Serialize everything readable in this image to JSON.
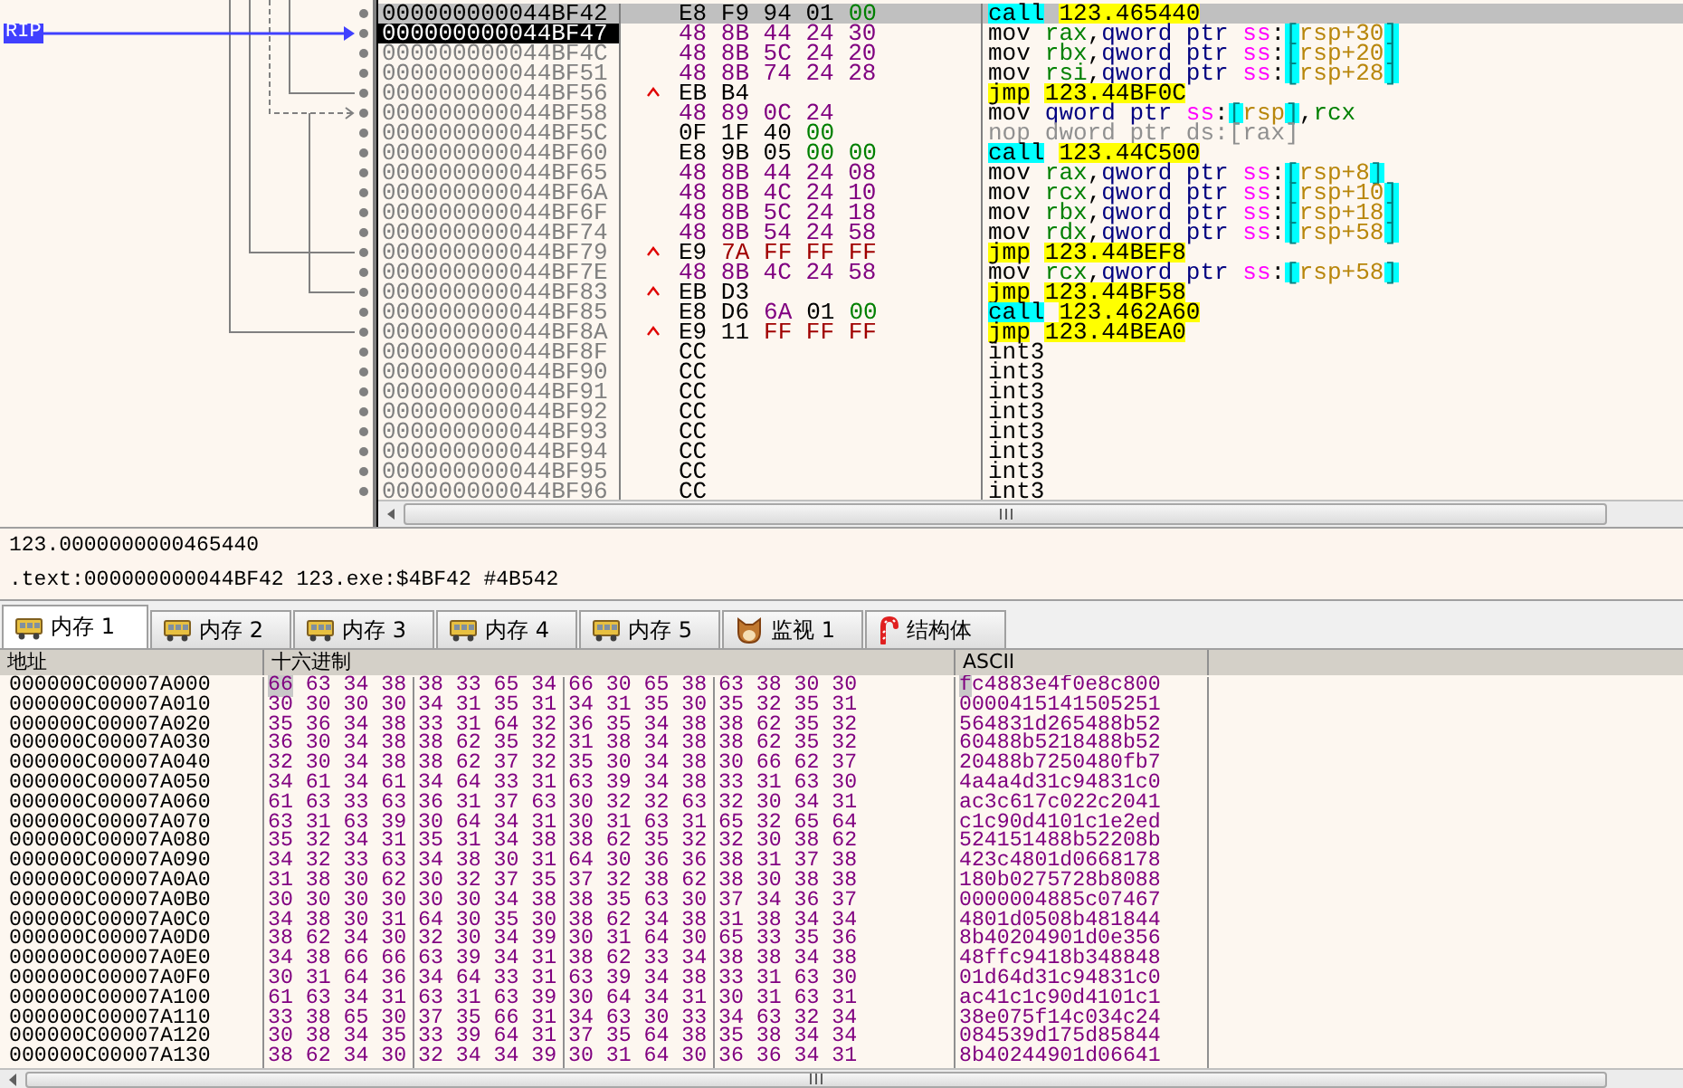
{
  "gutter": {
    "rip_label": "RIP"
  },
  "disassembly": [
    {
      "address": "000000000044BF42",
      "selected": true,
      "is_rip": false,
      "jump_up": false,
      "bytes": [
        {
          "text": "E8 F9 94 01",
          "kind": "opcode"
        },
        {
          "text": "00",
          "kind": "zero"
        }
      ],
      "instruction": [
        {
          "text": "call",
          "kind": "call"
        },
        {
          "text": "123.465440",
          "kind": "target"
        }
      ]
    },
    {
      "address": "000000000044BF47",
      "selected": false,
      "is_rip": true,
      "jump_up": false,
      "bytes": [
        {
          "text": "48 8B 44 24 30",
          "kind": "operand"
        }
      ],
      "instruction": [
        {
          "text": "mov",
          "kind": "mnemonic"
        },
        {
          "text": "rax",
          "kind": "register"
        },
        {
          "text": ",",
          "kind": "punct"
        },
        {
          "text": "qword ptr ",
          "kind": "size"
        },
        {
          "text": "ss",
          "kind": "segment"
        },
        {
          "text": ":",
          "kind": "punct"
        },
        {
          "text": "[",
          "kind": "bracket"
        },
        {
          "text": "rsp+30",
          "kind": "memory"
        },
        {
          "text": "]",
          "kind": "bracket"
        }
      ]
    },
    {
      "address": "000000000044BF4C",
      "selected": false,
      "is_rip": false,
      "jump_up": false,
      "bytes": [
        {
          "text": "48 8B 5C 24 20",
          "kind": "operand"
        }
      ],
      "instruction": [
        {
          "text": "mov",
          "kind": "mnemonic"
        },
        {
          "text": "rbx",
          "kind": "register"
        },
        {
          "text": ",",
          "kind": "punct"
        },
        {
          "text": "qword ptr ",
          "kind": "size"
        },
        {
          "text": "ss",
          "kind": "segment"
        },
        {
          "text": ":",
          "kind": "punct"
        },
        {
          "text": "[",
          "kind": "bracket"
        },
        {
          "text": "rsp+20",
          "kind": "memory"
        },
        {
          "text": "]",
          "kind": "bracket"
        }
      ]
    },
    {
      "address": "000000000044BF51",
      "selected": false,
      "is_rip": false,
      "jump_up": false,
      "bytes": [
        {
          "text": "48 8B 74 24 28",
          "kind": "operand"
        }
      ],
      "instruction": [
        {
          "text": "mov",
          "kind": "mnemonic"
        },
        {
          "text": "rsi",
          "kind": "register"
        },
        {
          "text": ",",
          "kind": "punct"
        },
        {
          "text": "qword ptr ",
          "kind": "size"
        },
        {
          "text": "ss",
          "kind": "segment"
        },
        {
          "text": ":",
          "kind": "punct"
        },
        {
          "text": "[",
          "kind": "bracket"
        },
        {
          "text": "rsp+28",
          "kind": "memory"
        },
        {
          "text": "]",
          "kind": "bracket"
        }
      ]
    },
    {
      "address": "000000000044BF56",
      "selected": false,
      "is_rip": false,
      "jump_up": true,
      "bytes": [
        {
          "text": "EB B4",
          "kind": "opcode"
        }
      ],
      "instruction": [
        {
          "text": "jmp",
          "kind": "jmp"
        },
        {
          "text": "123.44BF0C",
          "kind": "target"
        }
      ]
    },
    {
      "address": "000000000044BF58",
      "selected": false,
      "is_rip": false,
      "jump_up": false,
      "bytes": [
        {
          "text": "48 89 0C 24",
          "kind": "operand"
        }
      ],
      "instruction": [
        {
          "text": "mov",
          "kind": "mnemonic"
        },
        {
          "text": "qword ptr ",
          "kind": "size"
        },
        {
          "text": "ss",
          "kind": "segment"
        },
        {
          "text": ":",
          "kind": "punct"
        },
        {
          "text": "[",
          "kind": "bracket"
        },
        {
          "text": "rsp",
          "kind": "memory"
        },
        {
          "text": "]",
          "kind": "bracket"
        },
        {
          "text": ",",
          "kind": "punct"
        },
        {
          "text": "rcx",
          "kind": "register"
        }
      ]
    },
    {
      "address": "000000000044BF5C",
      "selected": false,
      "is_rip": false,
      "jump_up": false,
      "bytes": [
        {
          "text": "0F 1F 40",
          "kind": "opcode"
        },
        {
          "text": "00",
          "kind": "zero"
        }
      ],
      "instruction": [
        {
          "text": "nop",
          "kind": "nop"
        },
        {
          "text": "dword ptr ds:[rax]",
          "kind": "nop"
        }
      ]
    },
    {
      "address": "000000000044BF60",
      "selected": false,
      "is_rip": false,
      "jump_up": false,
      "bytes": [
        {
          "text": "E8 9B 05",
          "kind": "opcode"
        },
        {
          "text": "00 00",
          "kind": "zero"
        }
      ],
      "instruction": [
        {
          "text": "call",
          "kind": "call"
        },
        {
          "text": "123.44C500",
          "kind": "target"
        }
      ]
    },
    {
      "address": "000000000044BF65",
      "selected": false,
      "is_rip": false,
      "jump_up": false,
      "bytes": [
        {
          "text": "48 8B 44 24 08",
          "kind": "operand"
        }
      ],
      "instruction": [
        {
          "text": "mov",
          "kind": "mnemonic"
        },
        {
          "text": "rax",
          "kind": "register"
        },
        {
          "text": ",",
          "kind": "punct"
        },
        {
          "text": "qword ptr ",
          "kind": "size"
        },
        {
          "text": "ss",
          "kind": "segment"
        },
        {
          "text": ":",
          "kind": "punct"
        },
        {
          "text": "[",
          "kind": "bracket"
        },
        {
          "text": "rsp+8",
          "kind": "memory"
        },
        {
          "text": "]",
          "kind": "bracket"
        }
      ]
    },
    {
      "address": "000000000044BF6A",
      "selected": false,
      "is_rip": false,
      "jump_up": false,
      "bytes": [
        {
          "text": "48 8B 4C 24 10",
          "kind": "operand"
        }
      ],
      "instruction": [
        {
          "text": "mov",
          "kind": "mnemonic"
        },
        {
          "text": "rcx",
          "kind": "register"
        },
        {
          "text": ",",
          "kind": "punct"
        },
        {
          "text": "qword ptr ",
          "kind": "size"
        },
        {
          "text": "ss",
          "kind": "segment"
        },
        {
          "text": ":",
          "kind": "punct"
        },
        {
          "text": "[",
          "kind": "bracket"
        },
        {
          "text": "rsp+10",
          "kind": "memory"
        },
        {
          "text": "]",
          "kind": "bracket"
        }
      ]
    },
    {
      "address": "000000000044BF6F",
      "selected": false,
      "is_rip": false,
      "jump_up": false,
      "bytes": [
        {
          "text": "48 8B 5C 24 18",
          "kind": "operand"
        }
      ],
      "instruction": [
        {
          "text": "mov",
          "kind": "mnemonic"
        },
        {
          "text": "rbx",
          "kind": "register"
        },
        {
          "text": ",",
          "kind": "punct"
        },
        {
          "text": "qword ptr ",
          "kind": "size"
        },
        {
          "text": "ss",
          "kind": "segment"
        },
        {
          "text": ":",
          "kind": "punct"
        },
        {
          "text": "[",
          "kind": "bracket"
        },
        {
          "text": "rsp+18",
          "kind": "memory"
        },
        {
          "text": "]",
          "kind": "bracket"
        }
      ]
    },
    {
      "address": "000000000044BF74",
      "selected": false,
      "is_rip": false,
      "jump_up": false,
      "bytes": [
        {
          "text": "48 8B 54 24 58",
          "kind": "operand"
        }
      ],
      "instruction": [
        {
          "text": "mov",
          "kind": "mnemonic"
        },
        {
          "text": "rdx",
          "kind": "register"
        },
        {
          "text": ",",
          "kind": "punct"
        },
        {
          "text": "qword ptr ",
          "kind": "size"
        },
        {
          "text": "ss",
          "kind": "segment"
        },
        {
          "text": ":",
          "kind": "punct"
        },
        {
          "text": "[",
          "kind": "bracket"
        },
        {
          "text": "rsp+58",
          "kind": "memory"
        },
        {
          "text": "]",
          "kind": "bracket"
        }
      ]
    },
    {
      "address": "000000000044BF79",
      "selected": false,
      "is_rip": false,
      "jump_up": true,
      "bytes": [
        {
          "text": "E9",
          "kind": "opcode"
        },
        {
          "text": "7A FF FF FF",
          "kind": "negative"
        }
      ],
      "instruction": [
        {
          "text": "jmp",
          "kind": "jmp"
        },
        {
          "text": "123.44BEF8",
          "kind": "target"
        }
      ]
    },
    {
      "address": "000000000044BF7E",
      "selected": false,
      "is_rip": false,
      "jump_up": false,
      "bytes": [
        {
          "text": "48 8B 4C 24 58",
          "kind": "operand"
        }
      ],
      "instruction": [
        {
          "text": "mov",
          "kind": "mnemonic"
        },
        {
          "text": "rcx",
          "kind": "register"
        },
        {
          "text": ",",
          "kind": "punct"
        },
        {
          "text": "qword ptr ",
          "kind": "size"
        },
        {
          "text": "ss",
          "kind": "segment"
        },
        {
          "text": ":",
          "kind": "punct"
        },
        {
          "text": "[",
          "kind": "bracket"
        },
        {
          "text": "rsp+58",
          "kind": "memory"
        },
        {
          "text": "]",
          "kind": "bracket"
        }
      ]
    },
    {
      "address": "000000000044BF83",
      "selected": false,
      "is_rip": false,
      "jump_up": true,
      "bytes": [
        {
          "text": "EB D3",
          "kind": "opcode"
        }
      ],
      "instruction": [
        {
          "text": "jmp",
          "kind": "jmp"
        },
        {
          "text": "123.44BF58",
          "kind": "target"
        }
      ]
    },
    {
      "address": "000000000044BF85",
      "selected": false,
      "is_rip": false,
      "jump_up": false,
      "bytes": [
        {
          "text": "E8 D6",
          "kind": "opcode"
        },
        {
          "text": "6A",
          "kind": "operand"
        },
        {
          "text": "01",
          "kind": "opcode"
        },
        {
          "text": "00",
          "kind": "zero"
        }
      ],
      "instruction": [
        {
          "text": "call",
          "kind": "call"
        },
        {
          "text": "123.462A60",
          "kind": "target"
        }
      ]
    },
    {
      "address": "000000000044BF8A",
      "selected": false,
      "is_rip": false,
      "jump_up": true,
      "bytes": [
        {
          "text": "E9 11",
          "kind": "opcode"
        },
        {
          "text": "FF FF FF",
          "kind": "negative"
        }
      ],
      "instruction": [
        {
          "text": "jmp",
          "kind": "jmp"
        },
        {
          "text": "123.44BEA0",
          "kind": "target"
        }
      ]
    },
    {
      "address": "000000000044BF8F",
      "selected": false,
      "is_rip": false,
      "jump_up": false,
      "bytes": [
        {
          "text": "CC",
          "kind": "opcode"
        }
      ],
      "instruction": [
        {
          "text": "int3",
          "kind": "mnemonic"
        }
      ]
    },
    {
      "address": "000000000044BF90",
      "selected": false,
      "is_rip": false,
      "jump_up": false,
      "bytes": [
        {
          "text": "CC",
          "kind": "opcode"
        }
      ],
      "instruction": [
        {
          "text": "int3",
          "kind": "mnemonic"
        }
      ]
    },
    {
      "address": "000000000044BF91",
      "selected": false,
      "is_rip": false,
      "jump_up": false,
      "bytes": [
        {
          "text": "CC",
          "kind": "opcode"
        }
      ],
      "instruction": [
        {
          "text": "int3",
          "kind": "mnemonic"
        }
      ]
    },
    {
      "address": "000000000044BF92",
      "selected": false,
      "is_rip": false,
      "jump_up": false,
      "bytes": [
        {
          "text": "CC",
          "kind": "opcode"
        }
      ],
      "instruction": [
        {
          "text": "int3",
          "kind": "mnemonic"
        }
      ]
    },
    {
      "address": "000000000044BF93",
      "selected": false,
      "is_rip": false,
      "jump_up": false,
      "bytes": [
        {
          "text": "CC",
          "kind": "opcode"
        }
      ],
      "instruction": [
        {
          "text": "int3",
          "kind": "mnemonic"
        }
      ]
    },
    {
      "address": "000000000044BF94",
      "selected": false,
      "is_rip": false,
      "jump_up": false,
      "bytes": [
        {
          "text": "CC",
          "kind": "opcode"
        }
      ],
      "instruction": [
        {
          "text": "int3",
          "kind": "mnemonic"
        }
      ]
    },
    {
      "address": "000000000044BF95",
      "selected": false,
      "is_rip": false,
      "jump_up": false,
      "bytes": [
        {
          "text": "CC",
          "kind": "opcode"
        }
      ],
      "instruction": [
        {
          "text": "int3",
          "kind": "mnemonic"
        }
      ]
    },
    {
      "address": "000000000044BF96",
      "selected": false,
      "is_rip": false,
      "jump_up": false,
      "bytes": [
        {
          "text": "CC",
          "kind": "opcode"
        }
      ],
      "instruction": [
        {
          "text": "int3",
          "kind": "mnemonic"
        }
      ]
    }
  ],
  "info": [
    "123.0000000000465440",
    ".text:000000000044BF42 123.exe:$4BF42 #4B542"
  ],
  "tabs": [
    {
      "label": "内存 1",
      "kind": "memory",
      "selected": true
    },
    {
      "label": "内存 2",
      "kind": "memory",
      "selected": false
    },
    {
      "label": "内存 3",
      "kind": "memory",
      "selected": false
    },
    {
      "label": "内存 4",
      "kind": "memory",
      "selected": false
    },
    {
      "label": "内存 5",
      "kind": "memory",
      "selected": false
    },
    {
      "label": "监视 1",
      "kind": "watch",
      "selected": false
    },
    {
      "label": "结构体",
      "kind": "struct",
      "selected": false
    }
  ],
  "dump": {
    "columns": [
      "地址",
      "十六进制",
      "ASCII"
    ],
    "rows": [
      {
        "address": "000000C00007A000",
        "hex": [
          "66 63 34 38",
          "38 33 65 34",
          "66 30 65 38",
          "63 38 30 30"
        ],
        "ascii": "fc4883e4f0e8c800",
        "cursor": true
      },
      {
        "address": "000000C00007A010",
        "hex": [
          "30 30 30 30",
          "34 31 35 31",
          "34 31 35 30",
          "35 32 35 31"
        ],
        "ascii": "0000415141505251",
        "cursor": false
      },
      {
        "address": "000000C00007A020",
        "hex": [
          "35 36 34 38",
          "33 31 64 32",
          "36 35 34 38",
          "38 62 35 32"
        ],
        "ascii": "564831d265488b52",
        "cursor": false
      },
      {
        "address": "000000C00007A030",
        "hex": [
          "36 30 34 38",
          "38 62 35 32",
          "31 38 34 38",
          "38 62 35 32"
        ],
        "ascii": "60488b5218488b52",
        "cursor": false
      },
      {
        "address": "000000C00007A040",
        "hex": [
          "32 30 34 38",
          "38 62 37 32",
          "35 30 34 38",
          "30 66 62 37"
        ],
        "ascii": "20488b7250480fb7",
        "cursor": false
      },
      {
        "address": "000000C00007A050",
        "hex": [
          "34 61 34 61",
          "34 64 33 31",
          "63 39 34 38",
          "33 31 63 30"
        ],
        "ascii": "4a4a4d31c94831c0",
        "cursor": false
      },
      {
        "address": "000000C00007A060",
        "hex": [
          "61 63 33 63",
          "36 31 37 63",
          "30 32 32 63",
          "32 30 34 31"
        ],
        "ascii": "ac3c617c022c2041",
        "cursor": false
      },
      {
        "address": "000000C00007A070",
        "hex": [
          "63 31 63 39",
          "30 64 34 31",
          "30 31 63 31",
          "65 32 65 64"
        ],
        "ascii": "c1c90d4101c1e2ed",
        "cursor": false
      },
      {
        "address": "000000C00007A080",
        "hex": [
          "35 32 34 31",
          "35 31 34 38",
          "38 62 35 32",
          "32 30 38 62"
        ],
        "ascii": "524151488b52208b",
        "cursor": false
      },
      {
        "address": "000000C00007A090",
        "hex": [
          "34 32 33 63",
          "34 38 30 31",
          "64 30 36 36",
          "38 31 37 38"
        ],
        "ascii": "423c4801d0668178",
        "cursor": false
      },
      {
        "address": "000000C00007A0A0",
        "hex": [
          "31 38 30 62",
          "30 32 37 35",
          "37 32 38 62",
          "38 30 38 38"
        ],
        "ascii": "180b0275728b8088",
        "cursor": false
      },
      {
        "address": "000000C00007A0B0",
        "hex": [
          "30 30 30 30",
          "30 30 34 38",
          "38 35 63 30",
          "37 34 36 37"
        ],
        "ascii": "0000004885c07467",
        "cursor": false
      },
      {
        "address": "000000C00007A0C0",
        "hex": [
          "34 38 30 31",
          "64 30 35 30",
          "38 62 34 38",
          "31 38 34 34"
        ],
        "ascii": "4801d0508b481844",
        "cursor": false
      },
      {
        "address": "000000C00007A0D0",
        "hex": [
          "38 62 34 30",
          "32 30 34 39",
          "30 31 64 30",
          "65 33 35 36"
        ],
        "ascii": "8b40204901d0e356",
        "cursor": false
      },
      {
        "address": "000000C00007A0E0",
        "hex": [
          "34 38 66 66",
          "63 39 34 31",
          "38 62 33 34",
          "38 38 34 38"
        ],
        "ascii": "48ffc9418b348848",
        "cursor": false
      },
      {
        "address": "000000C00007A0F0",
        "hex": [
          "30 31 64 36",
          "34 64 33 31",
          "63 39 34 38",
          "33 31 63 30"
        ],
        "ascii": "01d64d31c94831c0",
        "cursor": false
      },
      {
        "address": "000000C00007A100",
        "hex": [
          "61 63 34 31",
          "63 31 63 39",
          "30 64 34 31",
          "30 31 63 31"
        ],
        "ascii": "ac41c1c90d4101c1",
        "cursor": false
      },
      {
        "address": "000000C00007A110",
        "hex": [
          "33 38 65 30",
          "37 35 66 31",
          "34 63 30 33",
          "34 63 32 34"
        ],
        "ascii": "38e075f14c034c24",
        "cursor": false
      },
      {
        "address": "000000C00007A120",
        "hex": [
          "30 38 34 35",
          "33 39 64 31",
          "37 35 64 38",
          "35 38 34 34"
        ],
        "ascii": "084539d175d85844",
        "cursor": false
      },
      {
        "address": "000000C00007A130",
        "hex": [
          "38 62 34 30",
          "32 34 34 39",
          "30 31 64 30",
          "36 36 34 31"
        ],
        "ascii": "8b40244901d06641",
        "cursor": false
      }
    ]
  }
}
